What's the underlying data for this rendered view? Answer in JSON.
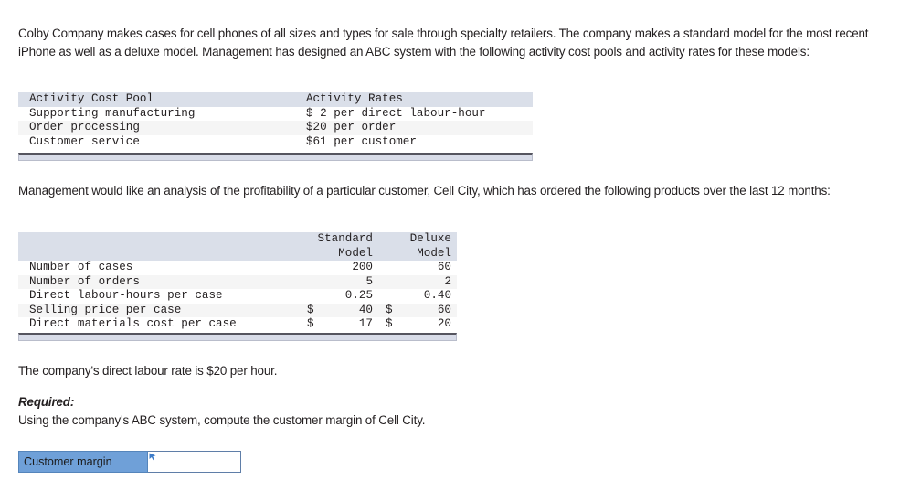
{
  "problem": {
    "intro_paragraph": "Colby Company makes cases for cell phones of all sizes and types for sale through specialty retailers. The company makes a standard model for the most recent iPhone as well as a deluxe model. Management has designed an ABC system with the following activity cost pools and activity rates for these models:",
    "analysis_paragraph": "Management would like an analysis of the profitability of a particular customer, Cell City, which has ordered the following products over the last 12 months:",
    "labour_rate_paragraph": "The company's direct labour rate is $20 per hour.",
    "required_label": "Required:",
    "required_text": "Using the company's ABC system, compute the customer margin of Cell City."
  },
  "activity_table": {
    "headers": [
      "Activity Cost Pool",
      "Activity Rates"
    ],
    "rows": [
      {
        "pool": "Supporting manufacturing",
        "rate": "$ 2 per direct labour-hour"
      },
      {
        "pool": "Order processing",
        "rate": "$20 per order"
      },
      {
        "pool": "Customer service",
        "rate": "$61 per customer"
      }
    ]
  },
  "customer_table": {
    "headers": [
      {
        "line1": "",
        "line2": ""
      },
      {
        "line1": "Standard",
        "line2": "Model"
      },
      {
        "line1": "Deluxe",
        "line2": "Model"
      }
    ],
    "rows": [
      {
        "label": "Number of cases",
        "standard_currency": "",
        "standard": "200",
        "deluxe_currency": "",
        "deluxe": "60"
      },
      {
        "label": "Number of orders",
        "standard_currency": "",
        "standard": "5",
        "deluxe_currency": "",
        "deluxe": "2"
      },
      {
        "label": "Direct labour-hours per case",
        "standard_currency": "",
        "standard": "0.25",
        "deluxe_currency": "",
        "deluxe": "0.40"
      },
      {
        "label": "Selling price per case",
        "standard_currency": "$",
        "standard": "40",
        "deluxe_currency": "$",
        "deluxe": "60"
      },
      {
        "label": "Direct materials cost per case",
        "standard_currency": "$",
        "standard": "17",
        "deluxe_currency": "$",
        "deluxe": "20"
      }
    ]
  },
  "answer": {
    "label": "Customer margin",
    "value": "",
    "placeholder": ""
  },
  "colors": {
    "table_header_bg": "#dadfe9",
    "table_stripe_bg": "#f5f5f5",
    "table_footer_bg": "#d8dce8",
    "answer_label_bg": "#6fa0d8",
    "answer_border": "#5f7ea8",
    "text": "#231f20"
  }
}
